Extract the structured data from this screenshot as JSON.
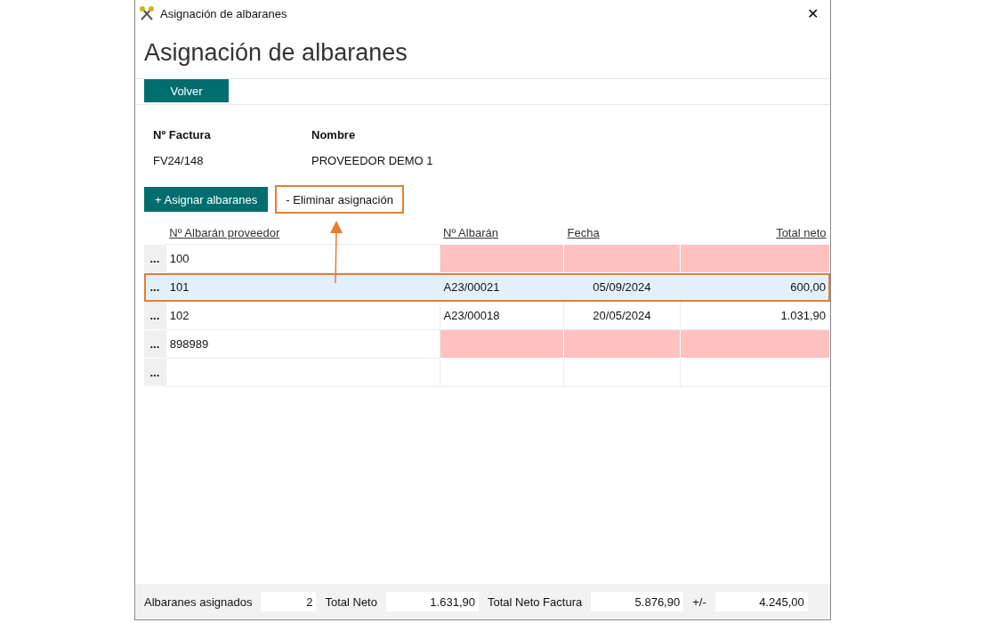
{
  "window": {
    "title": "Asignación de albaranes",
    "close": "✕"
  },
  "heading": "Asignación de albaranes",
  "toolbar": {
    "buttons": [
      {
        "label": "Volver"
      }
    ]
  },
  "invoice": {
    "fields": [
      {
        "label": "Nº Factura",
        "value": "FV24/148"
      },
      {
        "label": "Nombre",
        "value": "PROVEEDOR DEMO 1"
      }
    ]
  },
  "actions": [
    {
      "label": "+ Asignar albaranes",
      "kind": "primary",
      "highlighted": false
    },
    {
      "label": "- Eliminar asignación",
      "kind": "plain",
      "highlighted": true
    }
  ],
  "table": {
    "columns": [
      {
        "label": "Nº Albarán proveedor",
        "kind": "text"
      },
      {
        "label": "Nº Albarán",
        "kind": "text"
      },
      {
        "label": "Fecha",
        "kind": "date"
      },
      {
        "label": "Total neto",
        "kind": "amount"
      }
    ],
    "rows": [
      {
        "handle": "...",
        "cells": [
          "100",
          "",
          "",
          ""
        ],
        "unmatched": true,
        "selected": false,
        "highlighted": false
      },
      {
        "handle": "...",
        "cells": [
          "101",
          "A23/00021",
          "05/09/2024",
          "600,00"
        ],
        "unmatched": false,
        "selected": true,
        "highlighted": true
      },
      {
        "handle": "...",
        "cells": [
          "102",
          "A23/00018",
          "20/05/2024",
          "1.031,90"
        ],
        "unmatched": false,
        "selected": false,
        "highlighted": false
      },
      {
        "handle": "...",
        "cells": [
          "898989",
          "",
          "",
          ""
        ],
        "unmatched": true,
        "selected": false,
        "highlighted": false
      },
      {
        "handle": "...",
        "cells": [
          "",
          "",
          "",
          ""
        ],
        "unmatched": false,
        "selected": false,
        "highlighted": false
      }
    ]
  },
  "footer": [
    {
      "label": "Albaranes asignados",
      "value": "2",
      "kind": "narrow"
    },
    {
      "label": "Total Neto",
      "value": "1.631,90",
      "kind": "wide"
    },
    {
      "label": "Total Neto Factura",
      "value": "5.876,90",
      "kind": "wide"
    },
    {
      "label": "+/-",
      "value": "4.245,00",
      "kind": "wide"
    }
  ]
}
